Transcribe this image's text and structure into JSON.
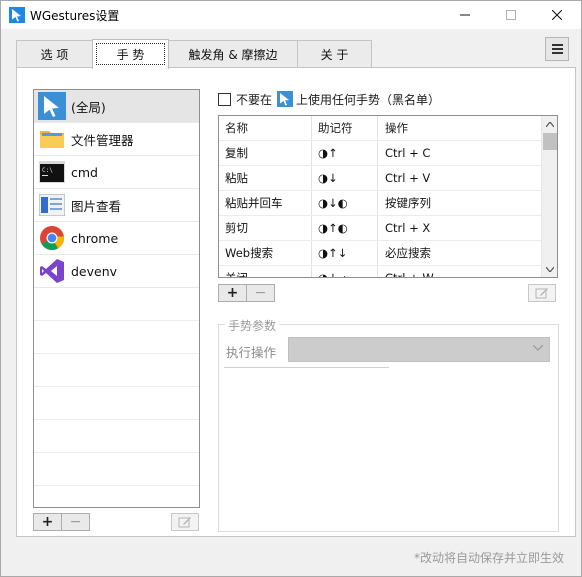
{
  "window": {
    "title": "WGestures设置"
  },
  "tabs": [
    {
      "label": "选 项",
      "active": false
    },
    {
      "label": "手 势",
      "active": true
    },
    {
      "label": "触发角 & 摩擦边",
      "active": false
    },
    {
      "label": "关 于",
      "active": false
    }
  ],
  "apps": [
    {
      "label": "(全局)",
      "icon": "cursor-icon",
      "selected": true
    },
    {
      "label": "文件管理器",
      "icon": "folder-icon",
      "selected": false
    },
    {
      "label": "cmd",
      "icon": "terminal-icon",
      "selected": false
    },
    {
      "label": "图片查看",
      "icon": "image-viewer-icon",
      "selected": false
    },
    {
      "label": "chrome",
      "icon": "chrome-icon",
      "selected": false
    },
    {
      "label": "devenv",
      "icon": "visual-studio-icon",
      "selected": false
    }
  ],
  "blacklist": {
    "prefix": "不要在",
    "suffix": "上使用任何手势（黑名单）",
    "checked": false
  },
  "gesture_table": {
    "columns": [
      "名称",
      "助记符",
      "操作"
    ],
    "rows": [
      {
        "name": "复制",
        "mnemonic": "◑↑",
        "action": "Ctrl + C"
      },
      {
        "name": "粘贴",
        "mnemonic": "◑↓",
        "action": "Ctrl + V"
      },
      {
        "name": "粘贴并回车",
        "mnemonic": "◑↓◐",
        "action": "按键序列"
      },
      {
        "name": "剪切",
        "mnemonic": "◑↑◐",
        "action": "Ctrl + X"
      },
      {
        "name": "Web搜索",
        "mnemonic": "◑↑↓",
        "action": "必应搜索"
      },
      {
        "name": "关闭",
        "mnemonic": "◑↓→",
        "action": "Ctrl + W"
      }
    ]
  },
  "buttons": {
    "add": "+",
    "remove": "−"
  },
  "params": {
    "legend": "手势参数",
    "exec_label": "执行操作",
    "exec_value": ""
  },
  "footnote": "*改动将自动保存并立即生效",
  "colors": {
    "selected_row": "#e5e5e5",
    "disabled_combo": "#cccccc",
    "hint_text": "#9a9a9a"
  }
}
